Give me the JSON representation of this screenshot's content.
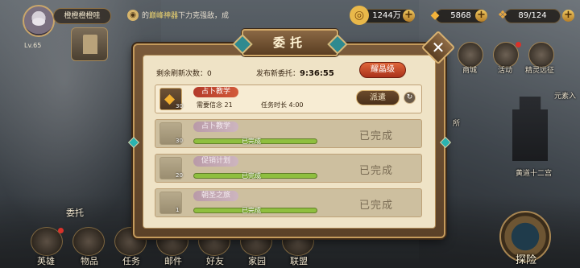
{
  "player": {
    "name": "橙橙橙橙哇",
    "level": "Lv.65"
  },
  "marquee": {
    "text_a": "的",
    "text_hl": "巅峰神器",
    "text_b": "下力克强敌，成"
  },
  "currencies": [
    {
      "icon": "gold-coin-icon",
      "value": "1244万"
    },
    {
      "icon": "diamond-icon",
      "value": "5868"
    },
    {
      "icon": "stamina-icon",
      "value": "89/124"
    }
  ],
  "right_menu": [
    {
      "label": "商城"
    },
    {
      "label": "活动"
    },
    {
      "label": "精灵远征"
    },
    {
      "label": "元素入"
    },
    {
      "label": "所"
    },
    {
      "label": "黄道十二宫"
    }
  ],
  "bottom_nav": [
    {
      "label": "英雄"
    },
    {
      "label": "物品"
    },
    {
      "label": "任务"
    },
    {
      "label": "邮件"
    },
    {
      "label": "好友"
    },
    {
      "label": "家园"
    },
    {
      "label": "联盟"
    }
  ],
  "left_label": "委托",
  "explore_label": "探险",
  "dialog": {
    "title": "委托",
    "close": "✕",
    "refresh_label": "剩余刷新次数：0",
    "publish_label": "发布新委托：",
    "timer": "9:36:55",
    "crystal_button": "耀晶级",
    "rows": [
      {
        "tag": "占卜教学",
        "qty": "30",
        "req": "需要信念 21",
        "duration": "任务时长 4:00",
        "send": "派遣",
        "refresh_icon": "↻"
      },
      {
        "tag": "占卜教学",
        "qty": "30",
        "bar": "已完成",
        "done": "已完成"
      },
      {
        "tag": "促销计划",
        "qty": "20",
        "bar": "已完成",
        "done": "已完成"
      },
      {
        "tag": "朝圣之旅",
        "qty": "1",
        "bar": "已完成",
        "done": "已完成"
      }
    ]
  },
  "colors": {
    "accent_red": "#c84a30",
    "bar_green": "#8fbf3f",
    "panel": "#efe3c6"
  }
}
